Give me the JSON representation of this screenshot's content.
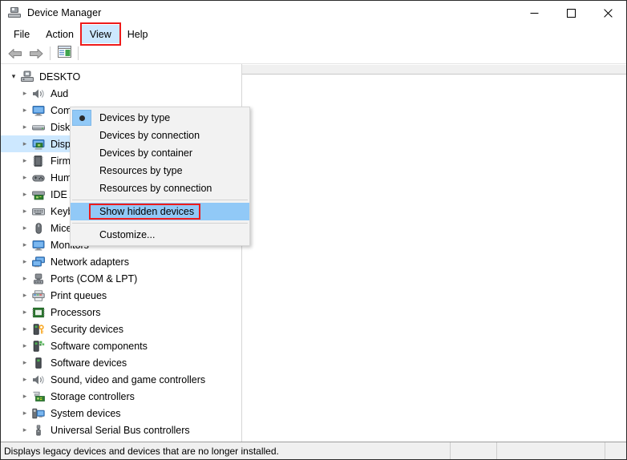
{
  "window": {
    "title": "Device Manager",
    "icon": "device-manager-icon",
    "controls": {
      "minimize": "—",
      "maximize": "□",
      "close": "✕"
    }
  },
  "menubar": {
    "items": [
      {
        "label": "File",
        "open": false,
        "annotated": false
      },
      {
        "label": "Action",
        "open": false,
        "annotated": false
      },
      {
        "label": "View",
        "open": true,
        "annotated": true
      },
      {
        "label": "Help",
        "open": false,
        "annotated": false
      }
    ]
  },
  "toolbar": {
    "back_label": "Back",
    "forward_label": "Forward",
    "show_hide_console_tree_label": "Show/Hide Console Tree"
  },
  "view_menu": {
    "items": [
      {
        "label": "Devices by type",
        "checked": true,
        "hovered": false,
        "annotated": false
      },
      {
        "label": "Devices by connection",
        "checked": false,
        "hovered": false,
        "annotated": false
      },
      {
        "label": "Devices by container",
        "checked": false,
        "hovered": false,
        "annotated": false
      },
      {
        "label": "Resources by type",
        "checked": false,
        "hovered": false,
        "annotated": false
      },
      {
        "label": "Resources by connection",
        "checked": false,
        "hovered": false,
        "annotated": false
      },
      {
        "separator_after": true,
        "label": "Show hidden devices",
        "checked": false,
        "hovered": true,
        "annotated": true
      },
      {
        "separator_before": true,
        "label": "Customize...",
        "checked": false,
        "hovered": false,
        "annotated": false
      }
    ]
  },
  "tree": {
    "root": {
      "label": "DESKTO",
      "icon": "computer-icon",
      "expanded": true,
      "selected": false
    },
    "items": [
      {
        "label": "Aud",
        "icon": "speaker-icon",
        "selected": false
      },
      {
        "label": "Com",
        "icon": "monitor-icon",
        "selected": false
      },
      {
        "label": "Disk",
        "icon": "disk-icon",
        "selected": false
      },
      {
        "label": "Disp",
        "icon": "display-adapter-icon",
        "selected": true
      },
      {
        "label": "Firm",
        "icon": "firmware-icon",
        "selected": false
      },
      {
        "label": "Hum",
        "icon": "gamepad-icon",
        "selected": false
      },
      {
        "label": "IDE A",
        "icon": "ide-controller-icon",
        "selected": false
      },
      {
        "label": "Keyboards",
        "icon": "keyboard-icon",
        "selected": false
      },
      {
        "label": "Mice and other pointing devices",
        "icon": "mouse-icon",
        "selected": false
      },
      {
        "label": "Monitors",
        "icon": "monitor-icon",
        "selected": false
      },
      {
        "label": "Network adapters",
        "icon": "network-adapter-icon",
        "selected": false
      },
      {
        "label": "Ports (COM & LPT)",
        "icon": "port-icon",
        "selected": false
      },
      {
        "label": "Print queues",
        "icon": "printer-icon",
        "selected": false
      },
      {
        "label": "Processors",
        "icon": "processor-icon",
        "selected": false
      },
      {
        "label": "Security devices",
        "icon": "security-device-icon",
        "selected": false
      },
      {
        "label": "Software components",
        "icon": "software-component-icon",
        "selected": false
      },
      {
        "label": "Software devices",
        "icon": "software-device-icon",
        "selected": false
      },
      {
        "label": "Sound, video and game controllers",
        "icon": "speaker-icon",
        "selected": false
      },
      {
        "label": "Storage controllers",
        "icon": "storage-controller-icon",
        "selected": false
      },
      {
        "label": "System devices",
        "icon": "system-device-icon",
        "selected": false
      },
      {
        "label": "Universal Serial Bus controllers",
        "icon": "usb-icon",
        "selected": false
      }
    ]
  },
  "statusbar": {
    "message": "Displays legacy devices and devices that are no longer installed.",
    "cell2": "",
    "cell3": "",
    "cell4": ""
  },
  "colors": {
    "accent_selection": "#cde8ff",
    "menu_hover": "#91c9f7",
    "annotation_red": "#ee1b1b",
    "chrome": "#f0f0f0"
  }
}
